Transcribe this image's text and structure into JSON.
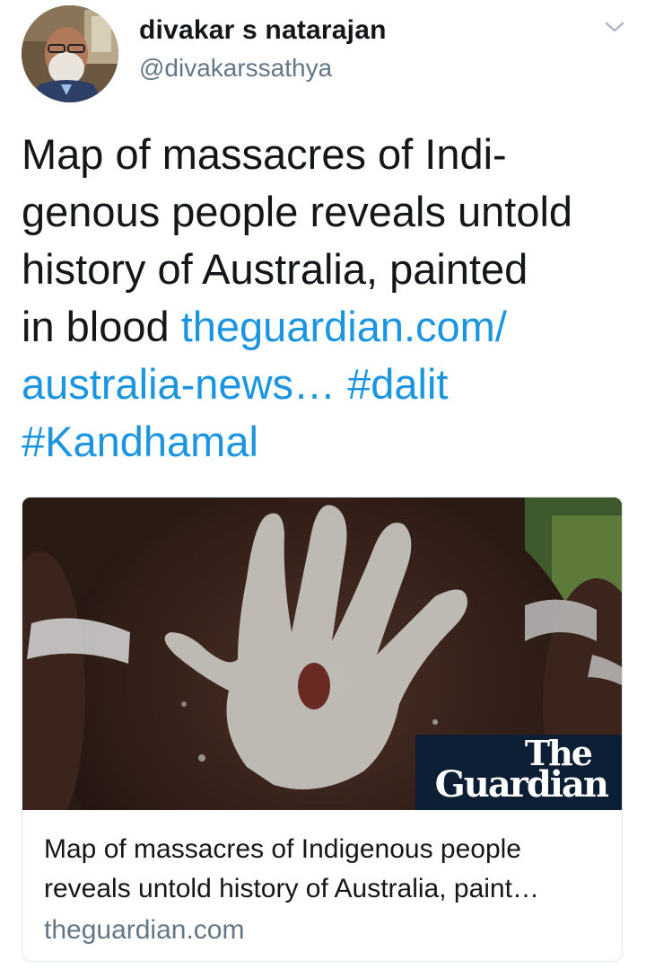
{
  "author": {
    "display_name": "divakar s natarajan",
    "handle": "@divakarssathya",
    "avatar_icon": "profile-photo"
  },
  "menu": {
    "icon": "chevron-down-icon"
  },
  "tweet": {
    "text_lines": [
      "Map of massacres of Indi-",
      "genous people reveals untold",
      "history of Australia, painted",
      "in blood "
    ],
    "link_part1": "theguardian.com/",
    "link_part2": "australia-news…",
    "hashtag1": "#dalit",
    "hashtag2": "#Kandhamal"
  },
  "card": {
    "image_desc_icon": "painted-handprint-image",
    "logo_the": "The",
    "logo_guardian": "Guardian",
    "title_lines": [
      "Map of massacres of Indigenous people",
      "reveals untold history of Australia, paint…"
    ],
    "domain": "theguardian.com"
  },
  "colors": {
    "link": "#1b95e0",
    "text": "#14171a",
    "secondary": "#657786",
    "border": "#e1e8ed",
    "guardian_navy": "#0d1f35"
  }
}
